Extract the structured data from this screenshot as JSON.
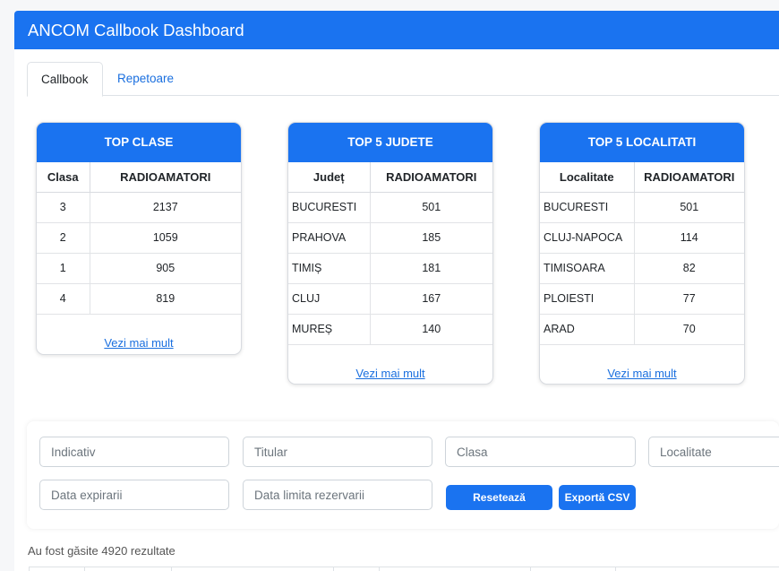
{
  "header": {
    "title": "ANCOM Callbook Dashboard"
  },
  "tabs": [
    {
      "label": "Callbook",
      "active": true
    },
    {
      "label": "Repetoare",
      "active": false
    }
  ],
  "cards": {
    "clase": {
      "title": "TOP CLASE",
      "col1": "Clasa",
      "col2": "RADIOAMATORI",
      "rows": [
        {
          "name": "3",
          "value": "2137"
        },
        {
          "name": "2",
          "value": "1059"
        },
        {
          "name": "1",
          "value": "905"
        },
        {
          "name": "4",
          "value": "819"
        }
      ],
      "more": "Vezi mai mult"
    },
    "judete": {
      "title": "TOP 5 JUDETE",
      "col1": "Județ",
      "col2": "RADIOAMATORI",
      "rows": [
        {
          "name": "BUCURESTI",
          "value": "501"
        },
        {
          "name": "PRAHOVA",
          "value": "185"
        },
        {
          "name": "TIMIȘ",
          "value": "181"
        },
        {
          "name": "CLUJ",
          "value": "167"
        },
        {
          "name": "MUREȘ",
          "value": "140"
        }
      ],
      "more": "Vezi mai mult"
    },
    "localitati": {
      "title": "TOP 5 LOCALITATI",
      "col1": "Localitate",
      "col2": "RADIOAMATORI",
      "rows": [
        {
          "name": "BUCURESTI",
          "value": "501"
        },
        {
          "name": "CLUJ-NAPOCA",
          "value": "114"
        },
        {
          "name": "TIMISOARA",
          "value": "82"
        },
        {
          "name": "PLOIESTI",
          "value": "77"
        },
        {
          "name": "ARAD",
          "value": "70"
        }
      ],
      "more": "Vezi mai mult"
    }
  },
  "filters": {
    "indicativ": "Indicativ",
    "titular": "Titular",
    "clasa": "Clasa",
    "localitate": "Localitate",
    "data_expirarii": "Data expirarii",
    "data_limita": "Data limita rezervarii",
    "reset_label": "Resetează",
    "export_label": "Exportă CSV"
  },
  "results_text": "Au fost găsite 4920 rezultate",
  "colors": {
    "primary": "#1a73f0",
    "link": "#1a6fdf"
  }
}
